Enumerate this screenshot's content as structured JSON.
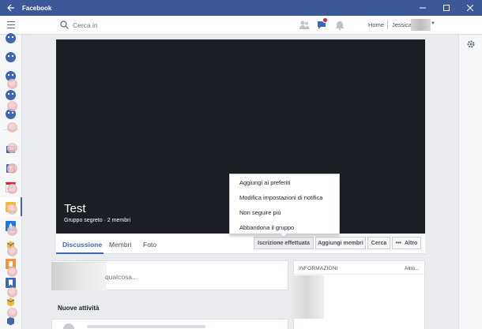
{
  "window": {
    "title": "Facebook",
    "back_icon": "arrow-left-icon",
    "controls": [
      "minimize-icon",
      "maximize-icon",
      "close-icon"
    ]
  },
  "header": {
    "search_placeholder": "Cerca in",
    "home_label": "Home",
    "user_name": "Jessica",
    "friend_requests_icon": "friends-icon",
    "messages_icon": "messenger-icon",
    "notifications_icon": "bell-icon",
    "badge_color": "#e41e3f"
  },
  "colors": {
    "brand": "#3b5998",
    "accent": "#4267b2",
    "cover": "#1c1e26"
  },
  "left_sidebar": {
    "icons": [
      "group-icon",
      "group-icon",
      "group-icon",
      "group-icon",
      "group-icon",
      "news-feed-icon",
      "contacts-icon",
      "calendar-icon",
      "groups-icon",
      "explore-icon",
      "box-icon",
      "pages-icon",
      "saved-icon",
      "box-icon",
      "box-icon"
    ],
    "calendar_day": "31"
  },
  "group": {
    "name": "Test",
    "meta": "Gruppo segreto · 2 membri"
  },
  "tabs": [
    "Discussione",
    "Membri",
    "Foto"
  ],
  "actions": {
    "joined": "Iscrizione effettuata",
    "add_members": "Aggiungi membri",
    "search": "Cerca",
    "more": "Altro"
  },
  "dropdown": {
    "items": [
      "Aggiungi ai preferiti",
      "Modifica impostazioni di notifica",
      "Non seguire più",
      "Abbandona il gruppo"
    ]
  },
  "composer": {
    "placeholder": "qualcosa..."
  },
  "feed": {
    "section_title": "Nuove attività"
  },
  "info": {
    "title": "INFORMAZIONI",
    "more": "Altro..."
  }
}
